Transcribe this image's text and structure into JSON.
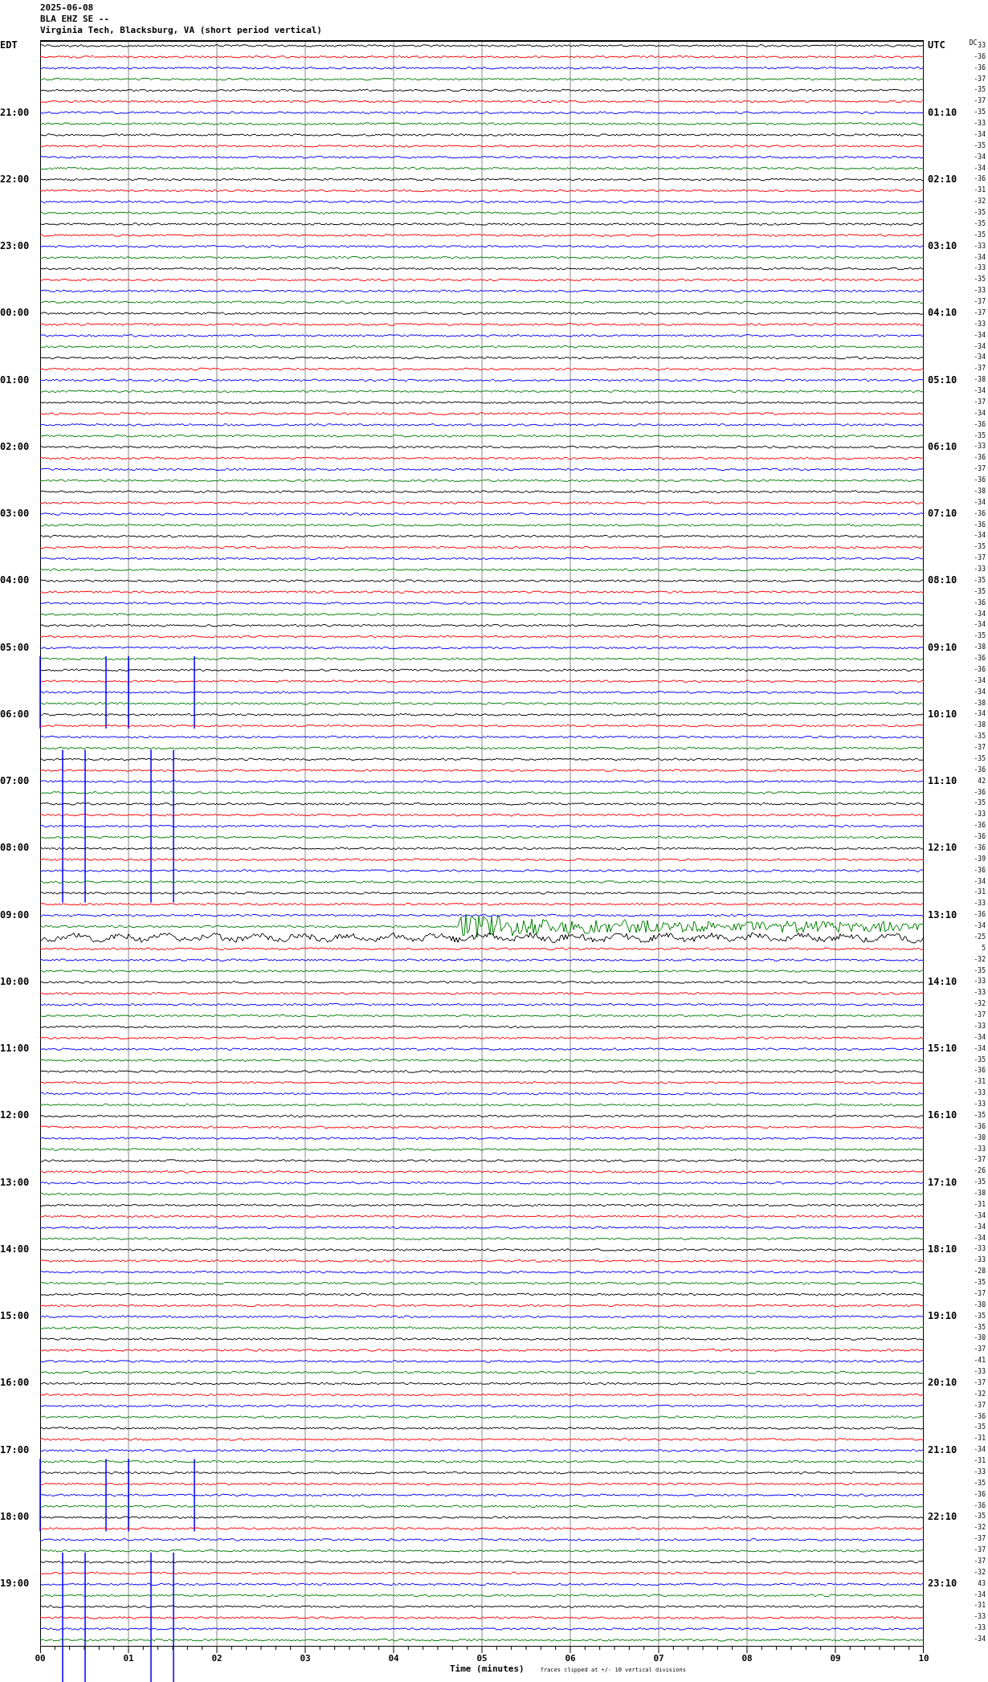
{
  "title_lines": [
    "2025-06-08",
    "BLA EHZ SE --",
    "Virginia Tech, Blacksburg, VA (short period vertical)"
  ],
  "left_header": "EDT",
  "right_header": "UTC",
  "dc_header": "DC",
  "traces": [
    {
      "color": "#000000",
      "kind": "quiet",
      "dc": "33"
    },
    {
      "color": "#ff0000",
      "kind": "quiet",
      "dc": "-36"
    },
    {
      "color": "#0000ff",
      "kind": "quiet",
      "dc": "-36"
    },
    {
      "color": "#007f00",
      "kind": "quiet",
      "dc": "-37"
    },
    {
      "color": "#000000",
      "kind": "quiet",
      "dc": "-35"
    },
    {
      "color": "#ff0000",
      "kind": "quiet",
      "dc": "-37"
    },
    {
      "color": "#0000ff",
      "kind": "quiet",
      "dc": "-35",
      "edt": "21:00",
      "utc": "01:10"
    },
    {
      "color": "#007f00",
      "kind": "quiet",
      "dc": "-33"
    },
    {
      "color": "#000000",
      "kind": "quiet",
      "dc": "-34"
    },
    {
      "color": "#ff0000",
      "kind": "quiet",
      "dc": "-35"
    },
    {
      "color": "#0000ff",
      "kind": "quiet",
      "dc": "-34"
    },
    {
      "color": "#007f00",
      "kind": "quiet",
      "dc": "-34"
    },
    {
      "color": "#000000",
      "kind": "quiet",
      "dc": "-36",
      "edt": "22:00",
      "utc": "02:10"
    },
    {
      "color": "#ff0000",
      "kind": "quiet",
      "dc": "-31"
    },
    {
      "color": "#0000ff",
      "kind": "quiet",
      "dc": "-32"
    },
    {
      "color": "#007f00",
      "kind": "quiet",
      "dc": "-35"
    },
    {
      "color": "#000000",
      "kind": "quiet",
      "dc": "-35"
    },
    {
      "color": "#ff0000",
      "kind": "quiet",
      "dc": "-35"
    },
    {
      "color": "#0000ff",
      "kind": "quiet",
      "dc": "-33",
      "edt": "23:00",
      "utc": "03:10"
    },
    {
      "color": "#007f00",
      "kind": "quiet",
      "dc": "-34"
    },
    {
      "color": "#000000",
      "kind": "quiet",
      "dc": "-33"
    },
    {
      "color": "#ff0000",
      "kind": "quiet",
      "dc": "-35"
    },
    {
      "color": "#0000ff",
      "kind": "quiet",
      "dc": "-33"
    },
    {
      "color": "#007f00",
      "kind": "quiet",
      "dc": "-37"
    },
    {
      "color": "#000000",
      "kind": "quiet",
      "dc": "-37",
      "edt": "00:00",
      "utc": "04:10"
    },
    {
      "color": "#ff0000",
      "kind": "quiet",
      "dc": "-33"
    },
    {
      "color": "#0000ff",
      "kind": "quiet",
      "dc": "-34"
    },
    {
      "color": "#007f00",
      "kind": "quiet",
      "dc": "-34"
    },
    {
      "color": "#000000",
      "kind": "quiet",
      "dc": "-34"
    },
    {
      "color": "#ff0000",
      "kind": "quiet",
      "dc": "-37"
    },
    {
      "color": "#0000ff",
      "kind": "quiet",
      "dc": "-38",
      "edt": "01:00",
      "utc": "05:10"
    },
    {
      "color": "#007f00",
      "kind": "quiet",
      "dc": "-34"
    },
    {
      "color": "#000000",
      "kind": "quiet",
      "dc": "-37"
    },
    {
      "color": "#ff0000",
      "kind": "quiet",
      "dc": "-34"
    },
    {
      "color": "#0000ff",
      "kind": "quiet",
      "dc": "-36"
    },
    {
      "color": "#007f00",
      "kind": "quiet",
      "dc": "-35"
    },
    {
      "color": "#000000",
      "kind": "quiet",
      "dc": "-33",
      "edt": "02:00",
      "utc": "06:10"
    },
    {
      "color": "#ff0000",
      "kind": "quiet",
      "dc": "-36"
    },
    {
      "color": "#0000ff",
      "kind": "quiet",
      "dc": "-37"
    },
    {
      "color": "#007f00",
      "kind": "quiet",
      "dc": "-36"
    },
    {
      "color": "#000000",
      "kind": "quiet",
      "dc": "-38"
    },
    {
      "color": "#ff0000",
      "kind": "quiet",
      "dc": "-34"
    },
    {
      "color": "#0000ff",
      "kind": "quiet",
      "dc": "-36",
      "edt": "03:00",
      "utc": "07:10"
    },
    {
      "color": "#007f00",
      "kind": "quiet",
      "dc": "-36"
    },
    {
      "color": "#000000",
      "kind": "quiet",
      "dc": "-34"
    },
    {
      "color": "#ff0000",
      "kind": "quiet",
      "dc": "-35"
    },
    {
      "color": "#0000ff",
      "kind": "quiet",
      "dc": "-37"
    },
    {
      "color": "#007f00",
      "kind": "quiet",
      "dc": "-33"
    },
    {
      "color": "#000000",
      "kind": "quiet",
      "dc": "-35",
      "edt": "04:00",
      "utc": "08:10"
    },
    {
      "color": "#ff0000",
      "kind": "quiet",
      "dc": "-35"
    },
    {
      "color": "#0000ff",
      "kind": "quiet",
      "dc": "-36"
    },
    {
      "color": "#007f00",
      "kind": "quiet",
      "dc": "-34"
    },
    {
      "color": "#000000",
      "kind": "quiet",
      "dc": "-34"
    },
    {
      "color": "#ff0000",
      "kind": "quiet",
      "dc": "-35"
    },
    {
      "color": "#0000ff",
      "kind": "quiet",
      "dc": "-38",
      "edt": "05:00",
      "utc": "09:10"
    },
    {
      "color": "#007f00",
      "kind": "quiet",
      "dc": "-36"
    },
    {
      "color": "#000000",
      "kind": "quiet",
      "dc": "-36"
    },
    {
      "color": "#ff0000",
      "kind": "quiet",
      "dc": "-34"
    },
    {
      "color": "#0000ff",
      "kind": "spikes",
      "dc": "-34"
    },
    {
      "color": "#007f00",
      "kind": "quiet",
      "dc": "-38"
    },
    {
      "color": "#000000",
      "kind": "quiet",
      "dc": "-34",
      "edt": "06:00",
      "utc": "10:10"
    },
    {
      "color": "#ff0000",
      "kind": "quiet",
      "dc": "-38"
    },
    {
      "color": "#0000ff",
      "kind": "quiet",
      "dc": "-35"
    },
    {
      "color": "#007f00",
      "kind": "quiet",
      "dc": "-37"
    },
    {
      "color": "#000000",
      "kind": "quiet",
      "dc": "-35"
    },
    {
      "color": "#ff0000",
      "kind": "quiet",
      "dc": "-36"
    },
    {
      "color": "#0000ff",
      "kind": "quiet",
      "dc": "42",
      "edt": "07:00",
      "utc": "11:10"
    },
    {
      "color": "#007f00",
      "kind": "quiet",
      "dc": "-36"
    },
    {
      "color": "#000000",
      "kind": "quiet",
      "dc": "-35"
    },
    {
      "color": "#ff0000",
      "kind": "quiet",
      "dc": "-33"
    },
    {
      "color": "#0000ff",
      "kind": "spikes",
      "dc": "-36"
    },
    {
      "color": "#007f00",
      "kind": "quiet",
      "dc": "-36"
    },
    {
      "color": "#000000",
      "kind": "quiet",
      "dc": "-36",
      "edt": "08:00",
      "utc": "12:10"
    },
    {
      "color": "#ff0000",
      "kind": "quiet",
      "dc": "-39"
    },
    {
      "color": "#0000ff",
      "kind": "quiet",
      "dc": "-36"
    },
    {
      "color": "#007f00",
      "kind": "quiet",
      "dc": "-34"
    },
    {
      "color": "#000000",
      "kind": "quiet",
      "dc": "-31"
    },
    {
      "color": "#ff0000",
      "kind": "quiet",
      "dc": "-33"
    },
    {
      "color": "#0000ff",
      "kind": "quiet",
      "dc": "-36",
      "edt": "09:00",
      "utc": "13:10"
    },
    {
      "color": "#007f00",
      "kind": "quake",
      "dc": "-34"
    },
    {
      "color": "#000000",
      "kind": "noisy",
      "dc": "-25"
    },
    {
      "color": "#ff0000",
      "kind": "quiet",
      "dc": "5"
    },
    {
      "color": "#0000ff",
      "kind": "quiet",
      "dc": "-32"
    },
    {
      "color": "#007f00",
      "kind": "quiet",
      "dc": "-35"
    },
    {
      "color": "#000000",
      "kind": "quiet",
      "dc": "-33",
      "edt": "10:00",
      "utc": "14:10"
    },
    {
      "color": "#ff0000",
      "kind": "quiet",
      "dc": "-33"
    },
    {
      "color": "#0000ff",
      "kind": "quiet",
      "dc": "-32"
    },
    {
      "color": "#007f00",
      "kind": "quiet",
      "dc": "-37"
    },
    {
      "color": "#000000",
      "kind": "quiet",
      "dc": "-33"
    },
    {
      "color": "#ff0000",
      "kind": "quiet",
      "dc": "-34"
    },
    {
      "color": "#0000ff",
      "kind": "quiet",
      "dc": "-34",
      "edt": "11:00",
      "utc": "15:10"
    },
    {
      "color": "#007f00",
      "kind": "quiet",
      "dc": "-35"
    },
    {
      "color": "#000000",
      "kind": "quiet",
      "dc": "-36"
    },
    {
      "color": "#ff0000",
      "kind": "quiet",
      "dc": "-31"
    },
    {
      "color": "#0000ff",
      "kind": "quiet",
      "dc": "-33"
    },
    {
      "color": "#007f00",
      "kind": "quiet",
      "dc": "-33"
    },
    {
      "color": "#000000",
      "kind": "quiet",
      "dc": "-35",
      "edt": "12:00",
      "utc": "16:10"
    },
    {
      "color": "#ff0000",
      "kind": "quiet",
      "dc": "-36"
    },
    {
      "color": "#0000ff",
      "kind": "quiet",
      "dc": "-30"
    },
    {
      "color": "#007f00",
      "kind": "quiet",
      "dc": "-33"
    },
    {
      "color": "#000000",
      "kind": "quiet",
      "dc": "-37"
    },
    {
      "color": "#ff0000",
      "kind": "quiet",
      "dc": "-26"
    },
    {
      "color": "#0000ff",
      "kind": "quiet",
      "dc": "-35",
      "edt": "13:00",
      "utc": "17:10"
    },
    {
      "color": "#007f00",
      "kind": "quiet",
      "dc": "-38"
    },
    {
      "color": "#000000",
      "kind": "quiet",
      "dc": "-31"
    },
    {
      "color": "#ff0000",
      "kind": "quiet",
      "dc": "-34"
    },
    {
      "color": "#0000ff",
      "kind": "quiet",
      "dc": "-34"
    },
    {
      "color": "#007f00",
      "kind": "quiet",
      "dc": "-34"
    },
    {
      "color": "#000000",
      "kind": "quiet",
      "dc": "-33",
      "edt": "14:00",
      "utc": "18:10"
    },
    {
      "color": "#ff0000",
      "kind": "quiet",
      "dc": "-33"
    },
    {
      "color": "#0000ff",
      "kind": "quiet",
      "dc": "-28"
    },
    {
      "color": "#007f00",
      "kind": "quiet",
      "dc": "-35"
    },
    {
      "color": "#000000",
      "kind": "quiet",
      "dc": "-37"
    },
    {
      "color": "#ff0000",
      "kind": "quiet",
      "dc": "-30"
    },
    {
      "color": "#0000ff",
      "kind": "quiet",
      "dc": "-35",
      "edt": "15:00",
      "utc": "19:10"
    },
    {
      "color": "#007f00",
      "kind": "quiet",
      "dc": "-35"
    },
    {
      "color": "#000000",
      "kind": "quiet",
      "dc": "-30"
    },
    {
      "color": "#ff0000",
      "kind": "quiet",
      "dc": "-37"
    },
    {
      "color": "#0000ff",
      "kind": "quiet",
      "dc": "-41"
    },
    {
      "color": "#007f00",
      "kind": "quiet",
      "dc": "-33"
    },
    {
      "color": "#000000",
      "kind": "quiet",
      "dc": "-37",
      "edt": "16:00",
      "utc": "20:10"
    },
    {
      "color": "#ff0000",
      "kind": "quiet",
      "dc": "-32"
    },
    {
      "color": "#0000ff",
      "kind": "quiet",
      "dc": "-37"
    },
    {
      "color": "#007f00",
      "kind": "quiet",
      "dc": "-36"
    },
    {
      "color": "#000000",
      "kind": "quiet",
      "dc": "-35"
    },
    {
      "color": "#ff0000",
      "kind": "quiet",
      "dc": "-31"
    },
    {
      "color": "#0000ff",
      "kind": "quiet",
      "dc": "-34",
      "edt": "17:00",
      "utc": "21:10"
    },
    {
      "color": "#007f00",
      "kind": "quiet",
      "dc": "-31"
    },
    {
      "color": "#000000",
      "kind": "quiet",
      "dc": "-33"
    },
    {
      "color": "#ff0000",
      "kind": "quiet",
      "dc": "-35"
    },
    {
      "color": "#0000ff",
      "kind": "spikes",
      "dc": "-36"
    },
    {
      "color": "#007f00",
      "kind": "quiet",
      "dc": "-36"
    },
    {
      "color": "#000000",
      "kind": "quiet",
      "dc": "-35",
      "edt": "18:00",
      "utc": "22:10"
    },
    {
      "color": "#ff0000",
      "kind": "quiet",
      "dc": "-32"
    },
    {
      "color": "#0000ff",
      "kind": "quiet",
      "dc": "-37"
    },
    {
      "color": "#007f00",
      "kind": "quiet",
      "dc": "-37"
    },
    {
      "color": "#000000",
      "kind": "quiet",
      "dc": "-37"
    },
    {
      "color": "#ff0000",
      "kind": "quiet",
      "dc": "-32"
    },
    {
      "color": "#0000ff",
      "kind": "quiet",
      "dc": "43",
      "edt": "19:00",
      "utc": "23:10"
    },
    {
      "color": "#007f00",
      "kind": "quiet",
      "dc": "-34"
    },
    {
      "color": "#000000",
      "kind": "quiet",
      "dc": "-31"
    },
    {
      "color": "#ff0000",
      "kind": "quiet",
      "dc": "-33"
    },
    {
      "color": "#0000ff",
      "kind": "spikes",
      "dc": "-33"
    },
    {
      "color": "#007f00",
      "kind": "quiet",
      "dc": "-34"
    }
  ],
  "x_axis": {
    "ticks": [
      "00",
      "01",
      "02",
      "03",
      "04",
      "05",
      "06",
      "07",
      "08",
      "09",
      "10"
    ],
    "label": "Time (minutes)",
    "note": "Traces clipped at +/- 10 vertical divisions"
  }
}
